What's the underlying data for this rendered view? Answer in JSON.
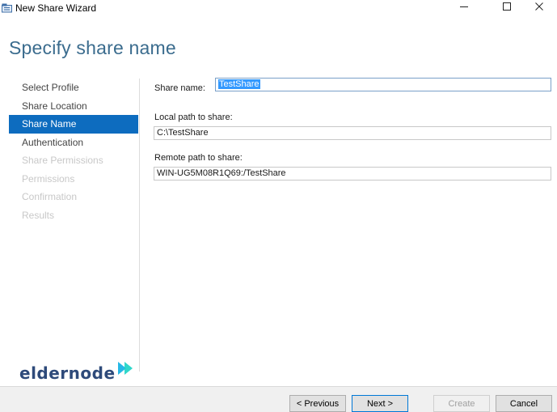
{
  "window": {
    "title": "New Share Wizard"
  },
  "page": {
    "title": "Specify share name"
  },
  "steps": [
    {
      "label": "Select Profile",
      "state": "normal"
    },
    {
      "label": "Share Location",
      "state": "normal"
    },
    {
      "label": "Share Name",
      "state": "active"
    },
    {
      "label": "Authentication",
      "state": "normal"
    },
    {
      "label": "Share Permissions",
      "state": "disabled"
    },
    {
      "label": "Permissions",
      "state": "disabled"
    },
    {
      "label": "Confirmation",
      "state": "disabled"
    },
    {
      "label": "Results",
      "state": "disabled"
    }
  ],
  "form": {
    "share_name_label": "Share name:",
    "share_name_value": "TestShare",
    "local_path_label": "Local path to share:",
    "local_path_value": "C:\\TestShare",
    "remote_path_label": "Remote path to share:",
    "remote_path_value": "WIN-UG5M08R1Q69:/TestShare"
  },
  "logo": {
    "text": "eldernode"
  },
  "buttons": {
    "previous": "< Previous",
    "next": "Next >",
    "create": "Create",
    "cancel": "Cancel"
  },
  "colors": {
    "accent": "#0d6cbf",
    "title": "#3b6c8e",
    "selection": "#3399ff"
  },
  "icons": {
    "app": "share-wizard-icon",
    "minimize": "minimize-icon",
    "maximize": "maximize-icon",
    "close": "close-icon"
  }
}
